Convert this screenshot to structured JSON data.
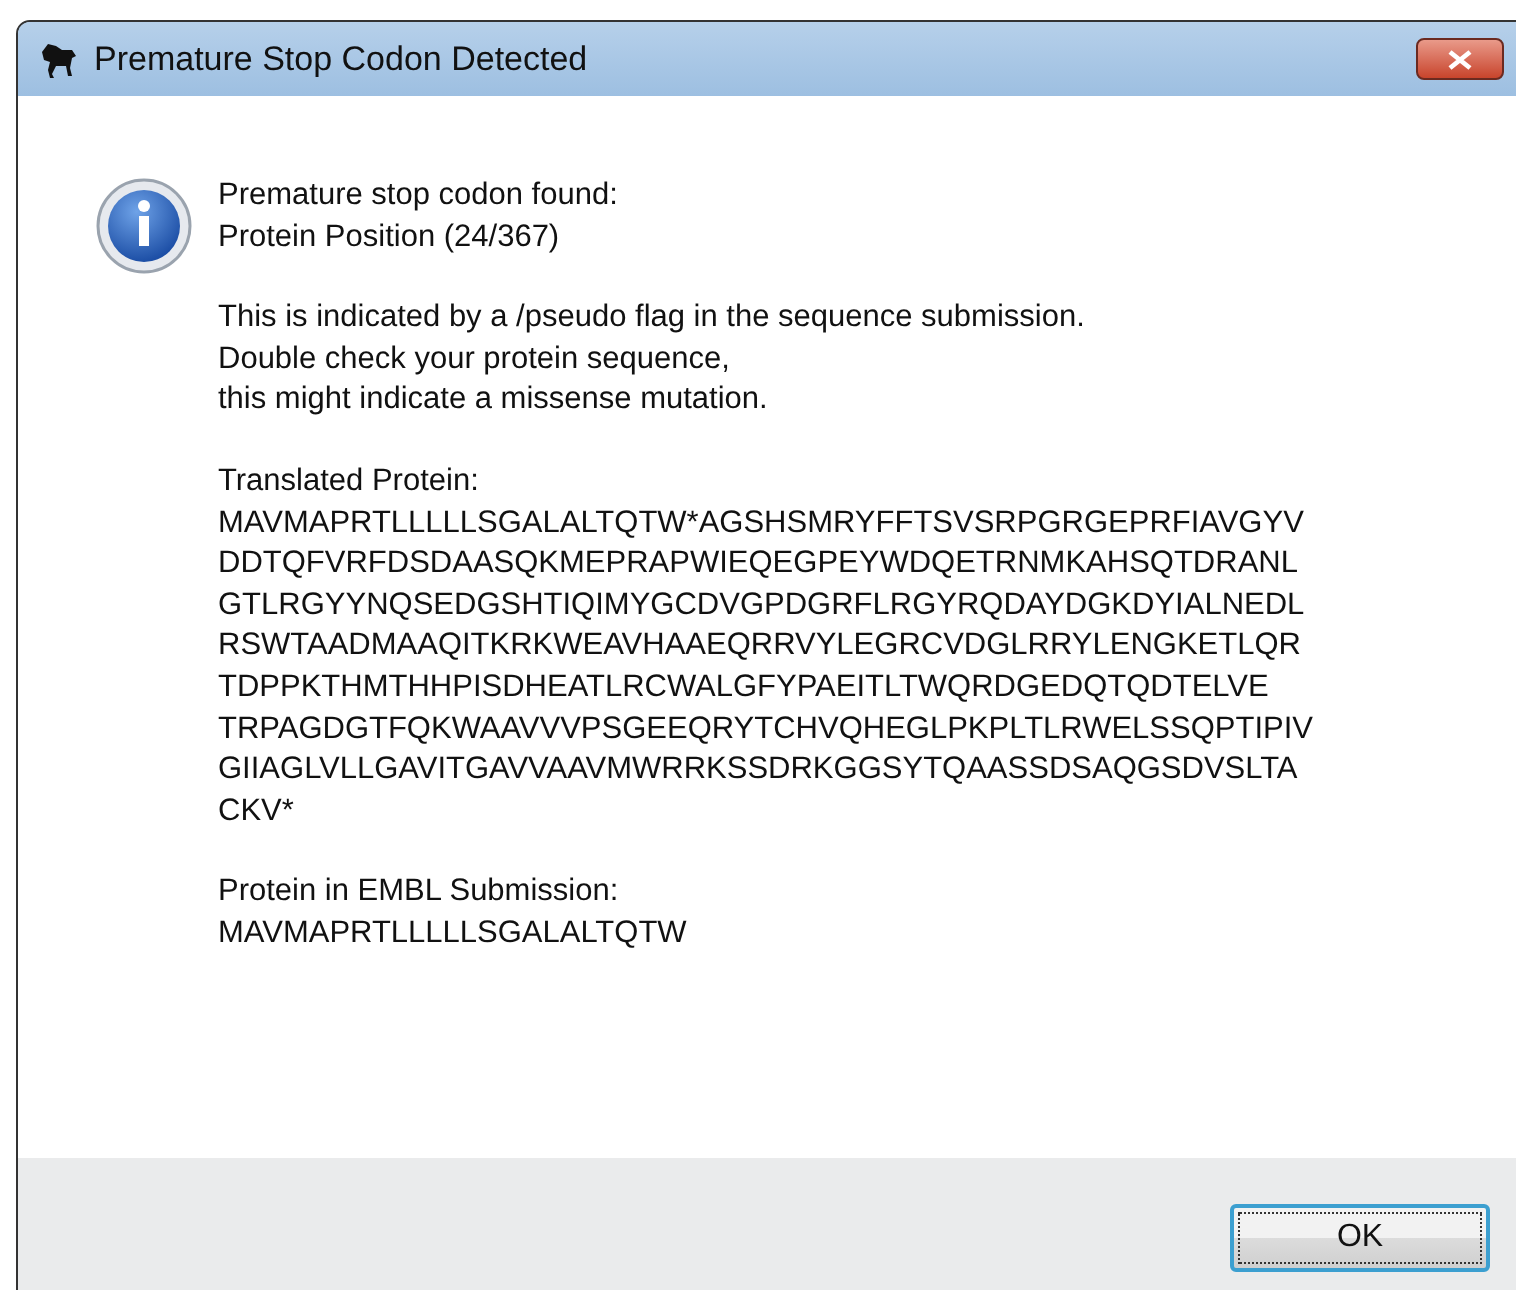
{
  "window": {
    "title": "Premature Stop Codon Detected"
  },
  "message": {
    "heading_lines": [
      "Premature stop codon found:",
      "Protein Position (24/367)"
    ],
    "note_lines": [
      "This is indicated by a /pseudo flag in the sequence submission.",
      "Double check your protein sequence,",
      "this might indicate a missense mutation."
    ],
    "translated_label": "Translated Protein:",
    "translated_lines": [
      "MAVMAPRTLLLLLSGALALTQTW*AGSHSMRYFFTSVSRPGRGEPRFIAVGYV",
      "DDTQFVRFDSDAASQKMEPRAPWIEQEGPEYWDQETRNMKAHSQTDRANL",
      "GTLRGYYNQSEDGSHTIQIMYGCDVGPDGRFLRGYRQDAYDGKDYIALNEDL",
      "RSWTAADMAAQITKRKWEAVHAAEQRRVYLEGRCVDGLRRYLENGKETLQR",
      "TDPPKTHMTHHPISDHEATLRCWALGFYPAEITLTWQRDGEDQTQDTELVE",
      "TRPAGDGTFQKWAAVVVPSGEEQRYTCHVQHEGLPKPLTLRWELSSQPTIPIV",
      "GIIAGLVLLGAVITGAVVAAVMWRRKSSDRKGGSYTQAASSDSAQGSDVSLTA",
      "CKV*"
    ],
    "embl_label": "Protein in EMBL Submission:",
    "embl_lines": [
      "MAVMAPRTLLLLLSGALALTQTW"
    ]
  },
  "buttons": [
    {
      "label": "OK",
      "focused": true
    }
  ]
}
